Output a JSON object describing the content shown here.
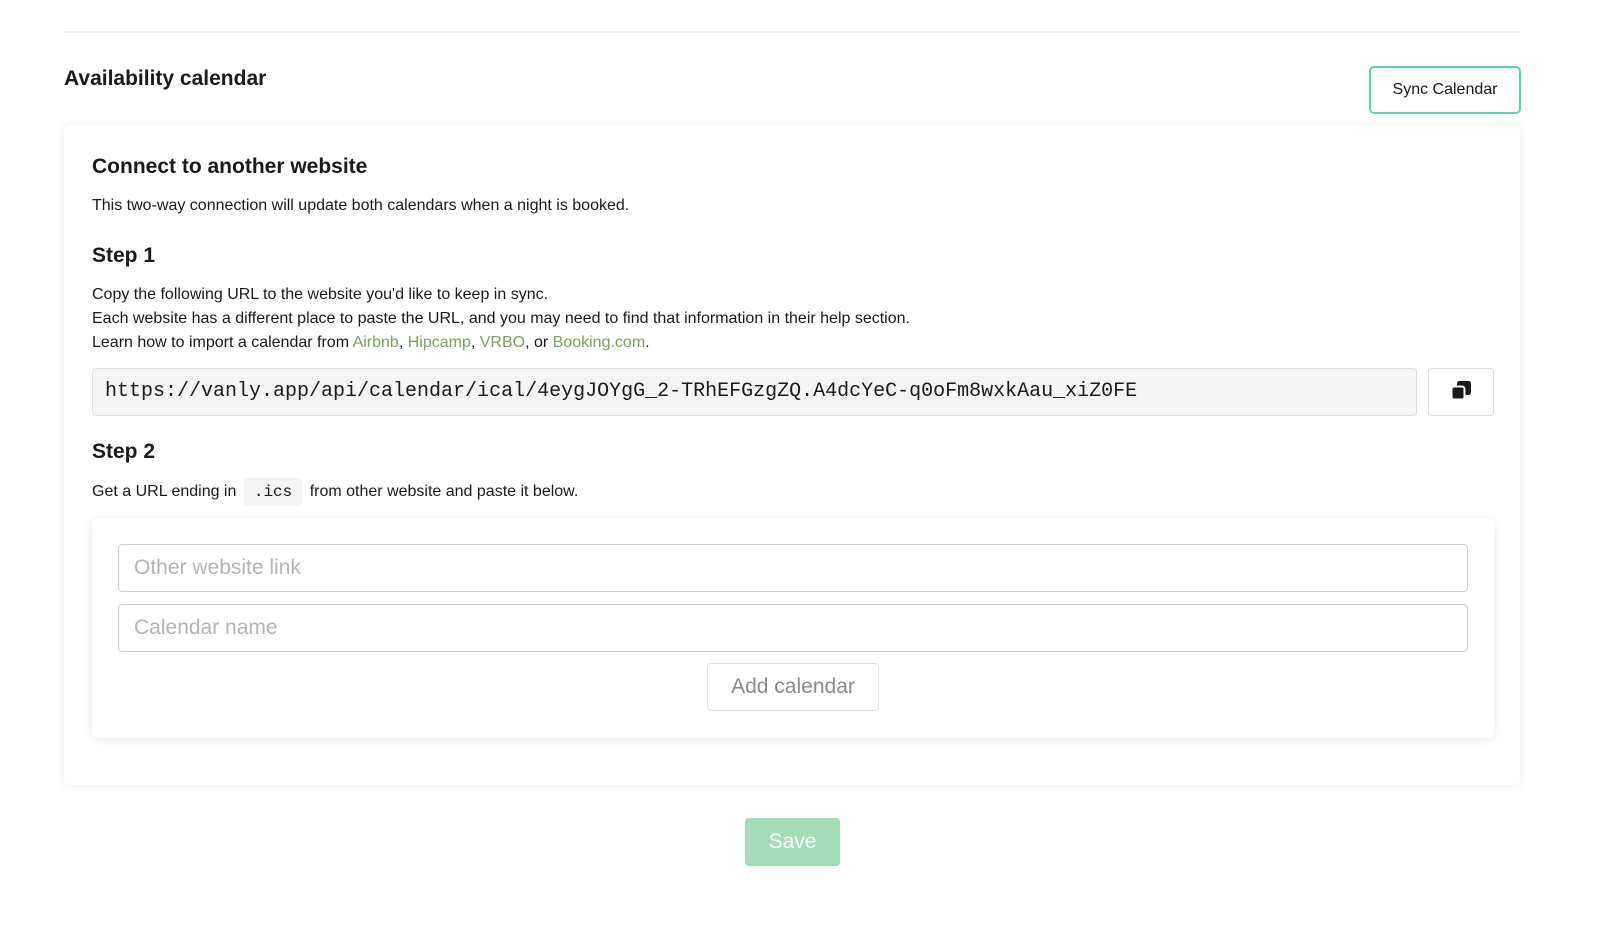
{
  "header": {
    "title": "Availability calendar",
    "sync_button_label": "Sync Calendar"
  },
  "connect": {
    "title": "Connect to another website",
    "description": "This two-way connection will update both calendars when a night is booked."
  },
  "step1": {
    "title": "Step 1",
    "line1": "Copy the following URL to the website you'd like to keep in sync.",
    "line2": "Each website has a different place to paste the URL, and you may need to find that information in their help section.",
    "line3_prefix": "Learn how to import a calendar from ",
    "links": [
      "Airbnb",
      "Hipcamp",
      "VRBO",
      "Booking.com"
    ],
    "sep1": ", ",
    "sep2": ", ",
    "sep3": ", or ",
    "end": ".",
    "calendar_url": "https://vanly.app/api/calendar/ical/4eygJOYgG_2-TRhEFGzgZQ.A4dcYeC-q0oFm8wxkAau_xiZ0FE",
    "copy_icon": "copy-icon"
  },
  "step2": {
    "title": "Step 2",
    "text_prefix": "Get a URL ending in",
    "code": ".ics",
    "text_suffix": "from other website and paste it below.",
    "link_placeholder": "Other website link",
    "name_placeholder": "Calendar name",
    "add_button_label": "Add calendar"
  },
  "footer": {
    "save_label": "Save"
  },
  "colors": {
    "accent_border": "#5fd0b8",
    "link": "#7c9e5f",
    "save_bg": "#a3dcb5"
  }
}
